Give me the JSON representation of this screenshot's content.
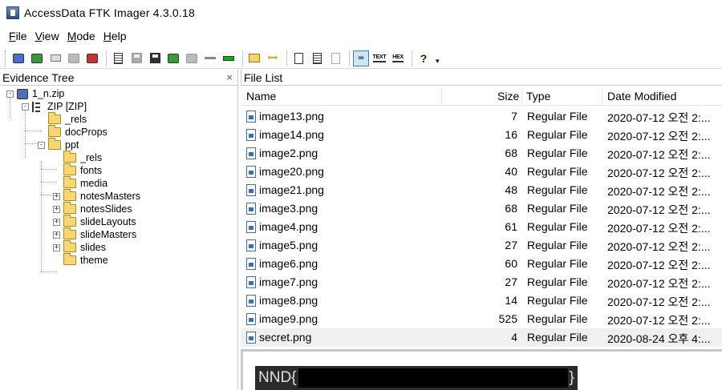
{
  "window": {
    "title": "AccessData FTK Imager 4.3.0.18"
  },
  "menu": {
    "items": [
      {
        "first": "F",
        "rest": "ile"
      },
      {
        "first": "V",
        "rest": "iew"
      },
      {
        "first": "M",
        "rest": "ode"
      },
      {
        "first": "H",
        "rest": "elp"
      }
    ]
  },
  "toolbar": {
    "text_label": "TEXT",
    "hex_label": "HEX",
    "help_glyph": "?",
    "overflow_glyph": "▾",
    "icons": [
      "add-evidence-icon",
      "add-all-evidence-icon",
      "image-mounting-icon",
      "unmount-icon",
      "remove-evidence-icon",
      "create-disk-image-icon",
      "export-disk-image-icon",
      "capture-memory-icon",
      "obtain-protected-files-icon",
      "detect-efs-icon",
      "export-files-icon",
      "hash-list-icon",
      "folder-icon",
      "key-icon",
      "page-icon",
      "text-page-icon",
      "image-page-icon",
      "natural-view-icon",
      "text-view-icon",
      "hex-view-icon",
      "help-icon"
    ]
  },
  "evidence_tree": {
    "title": "Evidence Tree",
    "close_glyph": "×",
    "nodes": [
      {
        "label": "1_n.zip",
        "expander": "-"
      },
      {
        "label": "ZIP [ZIP]",
        "expander": "-"
      },
      {
        "label": "_rels"
      },
      {
        "label": "docProps"
      },
      {
        "label": "ppt",
        "expander": "-"
      },
      {
        "label": "_rels"
      },
      {
        "label": "fonts"
      },
      {
        "label": "media"
      },
      {
        "label": "notesMasters",
        "expander": "+"
      },
      {
        "label": "notesSlides",
        "expander": "+"
      },
      {
        "label": "slideLayouts",
        "expander": "+"
      },
      {
        "label": "slideMasters",
        "expander": "+"
      },
      {
        "label": "slides",
        "expander": "+"
      },
      {
        "label": "theme"
      }
    ]
  },
  "file_list": {
    "title": "File List",
    "columns": {
      "name": "Name",
      "size": "Size",
      "type": "Type",
      "date": "Date Modified"
    },
    "rows": [
      {
        "name": "image13.png",
        "size": "7",
        "type": "Regular File",
        "date": "2020-07-12 오전 2:..."
      },
      {
        "name": "image14.png",
        "size": "16",
        "type": "Regular File",
        "date": "2020-07-12 오전 2:..."
      },
      {
        "name": "image2.png",
        "size": "68",
        "type": "Regular File",
        "date": "2020-07-12 오전 2:..."
      },
      {
        "name": "image20.png",
        "size": "40",
        "type": "Regular File",
        "date": "2020-07-12 오전 2:..."
      },
      {
        "name": "image21.png",
        "size": "48",
        "type": "Regular File",
        "date": "2020-07-12 오전 2:..."
      },
      {
        "name": "image3.png",
        "size": "68",
        "type": "Regular File",
        "date": "2020-07-12 오전 2:..."
      },
      {
        "name": "image4.png",
        "size": "61",
        "type": "Regular File",
        "date": "2020-07-12 오전 2:..."
      },
      {
        "name": "image5.png",
        "size": "27",
        "type": "Regular File",
        "date": "2020-07-12 오전 2:..."
      },
      {
        "name": "image6.png",
        "size": "60",
        "type": "Regular File",
        "date": "2020-07-12 오전 2:..."
      },
      {
        "name": "image7.png",
        "size": "27",
        "type": "Regular File",
        "date": "2020-07-12 오전 2:..."
      },
      {
        "name": "image8.png",
        "size": "14",
        "type": "Regular File",
        "date": "2020-07-12 오전 2:..."
      },
      {
        "name": "image9.png",
        "size": "525",
        "type": "Regular File",
        "date": "2020-07-12 오전 2:..."
      },
      {
        "name": "secret.png",
        "size": "4",
        "type": "Regular File",
        "date": "2020-08-24 오후 4:..."
      }
    ]
  },
  "viewer": {
    "prefix": "NND{",
    "suffix": "}"
  }
}
